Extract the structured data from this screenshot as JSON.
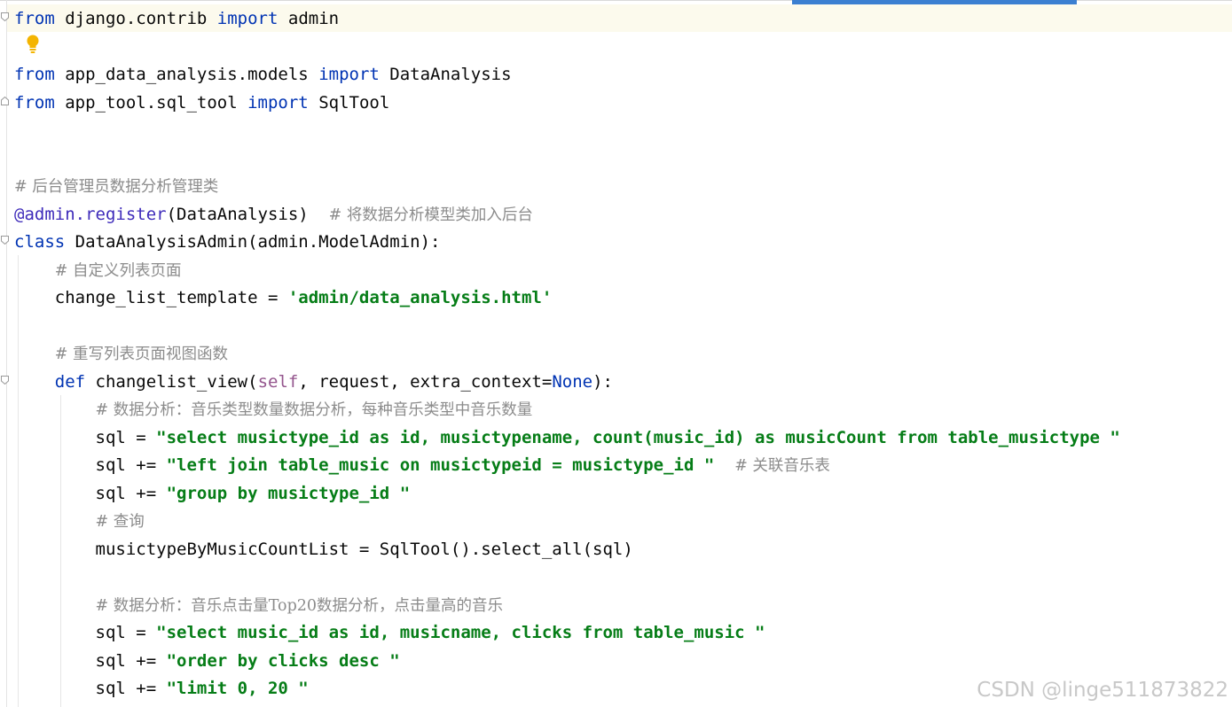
{
  "editor": {
    "lines": [
      {
        "segments": [
          {
            "t": "from",
            "c": "kw"
          },
          {
            "t": " django.contrib ",
            "c": ""
          },
          {
            "t": "import",
            "c": "kw"
          },
          {
            "t": " admin",
            "c": ""
          }
        ]
      },
      {
        "segments": []
      },
      {
        "segments": [
          {
            "t": "from",
            "c": "kw"
          },
          {
            "t": " app_data_analysis.models ",
            "c": ""
          },
          {
            "t": "import",
            "c": "kw"
          },
          {
            "t": " DataAnalysis",
            "c": ""
          }
        ]
      },
      {
        "segments": [
          {
            "t": "from",
            "c": "kw"
          },
          {
            "t": " app_tool.sql_tool ",
            "c": ""
          },
          {
            "t": "import",
            "c": "kw"
          },
          {
            "t": " SqlTool",
            "c": ""
          }
        ]
      },
      {
        "segments": []
      },
      {
        "segments": []
      },
      {
        "segments": [
          {
            "t": "# 后台管理员数据分析管理类",
            "c": "comment"
          }
        ]
      },
      {
        "segments": [
          {
            "t": "@admin.register",
            "c": "deco"
          },
          {
            "t": "(DataAnalysis)  ",
            "c": ""
          },
          {
            "t": "# 将数据分析模型类加入后台",
            "c": "comment"
          }
        ]
      },
      {
        "segments": [
          {
            "t": "class",
            "c": "kw"
          },
          {
            "t": " DataAnalysisAdmin(admin.ModelAdmin):",
            "c": ""
          }
        ]
      },
      {
        "segments": [
          {
            "t": "    ",
            "c": ""
          },
          {
            "t": "# 自定义列表页面",
            "c": "comment"
          }
        ]
      },
      {
        "segments": [
          {
            "t": "    change_list_template = ",
            "c": ""
          },
          {
            "t": "'admin/data_analysis.html'",
            "c": "str"
          }
        ]
      },
      {
        "segments": []
      },
      {
        "segments": [
          {
            "t": "    ",
            "c": ""
          },
          {
            "t": "# 重写列表页面视图函数",
            "c": "comment"
          }
        ]
      },
      {
        "segments": [
          {
            "t": "    ",
            "c": ""
          },
          {
            "t": "def",
            "c": "kw"
          },
          {
            "t": " changelist_view(",
            "c": ""
          },
          {
            "t": "self",
            "c": "self"
          },
          {
            "t": ", request, extra_context=",
            "c": ""
          },
          {
            "t": "None",
            "c": "const"
          },
          {
            "t": "):",
            "c": ""
          }
        ]
      },
      {
        "segments": [
          {
            "t": "        ",
            "c": ""
          },
          {
            "t": "# 数据分析：音乐类型数量数据分析，每种音乐类型中音乐数量",
            "c": "comment"
          }
        ]
      },
      {
        "segments": [
          {
            "t": "        sql = ",
            "c": ""
          },
          {
            "t": "\"select musictype_id as id, musictypename, count(music_id) as musicCount from table_musictype \"",
            "c": "str"
          }
        ]
      },
      {
        "segments": [
          {
            "t": "        sql += ",
            "c": ""
          },
          {
            "t": "\"left join table_music on musictypeid = musictype_id \"",
            "c": "str"
          },
          {
            "t": "  ",
            "c": ""
          },
          {
            "t": "# 关联音乐表",
            "c": "comment"
          }
        ]
      },
      {
        "segments": [
          {
            "t": "        sql += ",
            "c": ""
          },
          {
            "t": "\"group by musictype_id \"",
            "c": "str"
          }
        ]
      },
      {
        "segments": [
          {
            "t": "        ",
            "c": ""
          },
          {
            "t": "# 查询",
            "c": "comment"
          }
        ]
      },
      {
        "segments": [
          {
            "t": "        musictypeByMusicCountList = SqlTool().select_all(sql)",
            "c": ""
          }
        ]
      },
      {
        "segments": []
      },
      {
        "segments": [
          {
            "t": "        ",
            "c": ""
          },
          {
            "t": "# 数据分析：音乐点击量Top20数据分析，点击量高的音乐",
            "c": "comment"
          }
        ]
      },
      {
        "segments": [
          {
            "t": "        sql = ",
            "c": ""
          },
          {
            "t": "\"select music_id as id, musicname, clicks from table_music \"",
            "c": "str"
          }
        ]
      },
      {
        "segments": [
          {
            "t": "        sql += ",
            "c": ""
          },
          {
            "t": "\"order by clicks desc \"",
            "c": "str"
          }
        ]
      },
      {
        "segments": [
          {
            "t": "        sql += ",
            "c": ""
          },
          {
            "t": "\"limit 0, 20 \"",
            "c": "str"
          }
        ]
      }
    ],
    "colors": {
      "keyword": "#0033b3",
      "string": "#067d17",
      "comment": "#8c8c8c",
      "decorator": "#3e2bba",
      "self": "#94558d",
      "current_line": "#fcfaed",
      "bulb": "#f4b400",
      "scroll_indicator": "#3b7fd1"
    },
    "icons": {
      "fold": "fold-marker-icon",
      "intention": "lightbulb-icon"
    }
  },
  "watermark": "CSDN @linge511873822"
}
